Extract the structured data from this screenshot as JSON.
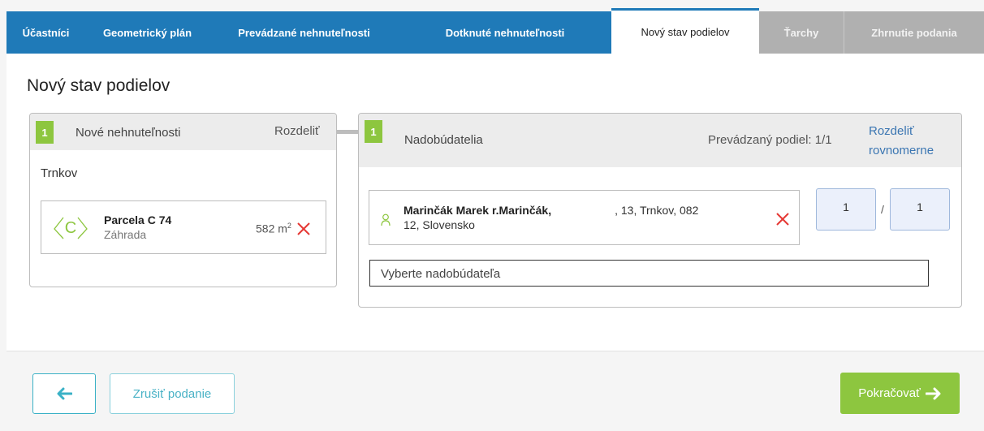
{
  "tabs": [
    {
      "label": "Účastníci",
      "state": "default"
    },
    {
      "label": "Geometrický plán",
      "state": "default"
    },
    {
      "label": "Prevádzané nehnuteľnosti",
      "state": "default"
    },
    {
      "label": "Dotknuté nehnuteľnosti",
      "state": "default"
    },
    {
      "label": "Nový stav podielov",
      "state": "active"
    },
    {
      "label": "Ťarchy",
      "state": "disabled"
    },
    {
      "label": "Zhrnutie podania",
      "state": "disabled"
    }
  ],
  "page": {
    "title": "Nový stav podielov"
  },
  "properties_card": {
    "number": "1",
    "title": "Nové nehnuteľnosti",
    "split_label": "Rozdeliť",
    "locality": "Trnkov",
    "parcel": {
      "icon": "parcel-c-icon",
      "name": "Parcela C 74",
      "type": "Záhrada",
      "area_value": "582 m",
      "area_unit_sup": "2",
      "remove_icon": "close-icon"
    }
  },
  "acquirers_card": {
    "number": "1",
    "title": "Nadobúdatelia",
    "transferred_share": "Prevádzaný podiel: 1/1",
    "split_evenly_line1": "Rozdeliť",
    "split_evenly_line2": "rovnomerne",
    "owner": {
      "icon": "person-icon",
      "name": "Marinčák Marek r.Marinčák,",
      "address_part1": ", 13, Trnkov, 082",
      "address_part2": "12, Slovensko",
      "remove_icon": "close-icon"
    },
    "share_numerator": "1",
    "share_separator": "/",
    "share_denominator": "1",
    "select_placeholder": "Vyberte nadobúdateľa"
  },
  "footer": {
    "back_icon": "arrow-left-icon",
    "cancel_label": "Zrušiť podanie",
    "next_label": "Pokračovať",
    "next_icon": "arrow-right-icon"
  },
  "colors": {
    "tab_bar": "#1f7ab8",
    "accent_green": "#8dc63f",
    "link": "#3b76b2",
    "danger": "#e53935",
    "teal": "#3ab1c6"
  }
}
